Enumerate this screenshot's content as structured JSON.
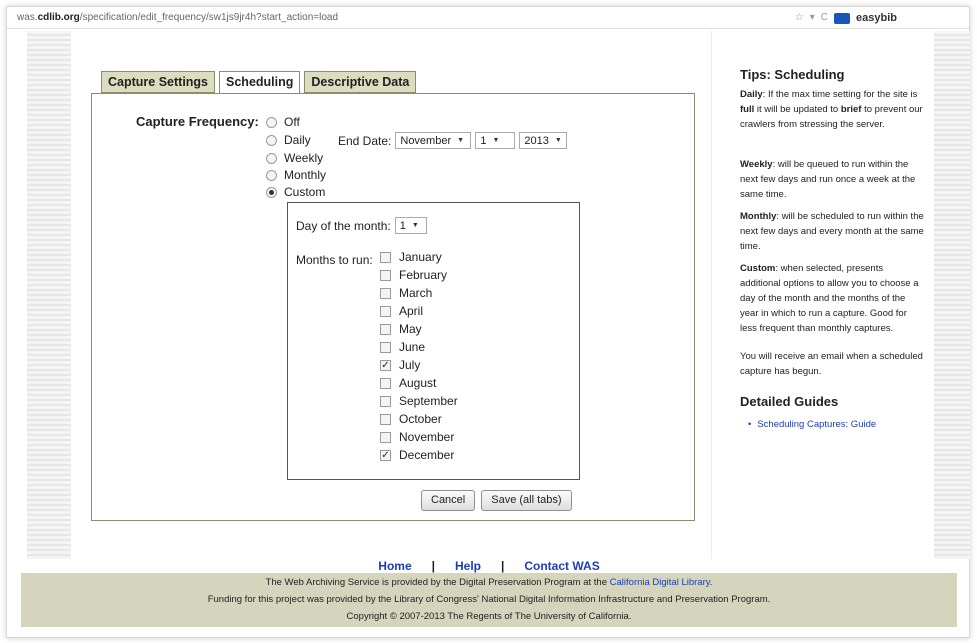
{
  "browser": {
    "url_prefix": "was.",
    "url_domain": "cdlib.org",
    "url_path": "/specification/edit_frequency/sw1js9jr4h?start_action=load",
    "search_engine": "easybib"
  },
  "tabs": [
    {
      "label": "Capture Settings"
    },
    {
      "label": "Scheduling"
    },
    {
      "label": "Descriptive Data"
    }
  ],
  "form": {
    "capture_frequency_label": "Capture Frequency:",
    "options": [
      {
        "label": "Off",
        "selected": false
      },
      {
        "label": "Daily",
        "selected": false
      },
      {
        "label": "Weekly",
        "selected": false
      },
      {
        "label": "Monthly",
        "selected": false
      },
      {
        "label": "Custom",
        "selected": true
      }
    ],
    "end_date": {
      "label": "End Date:",
      "month": "November",
      "day": "1",
      "year": "2013"
    },
    "custom": {
      "day_of_month_label": "Day of the month:",
      "day_of_month_value": "1",
      "months_label": "Months to run:",
      "months": [
        {
          "name": "January",
          "checked": false
        },
        {
          "name": "February",
          "checked": false
        },
        {
          "name": "March",
          "checked": false
        },
        {
          "name": "April",
          "checked": false
        },
        {
          "name": "May",
          "checked": false
        },
        {
          "name": "June",
          "checked": false
        },
        {
          "name": "July",
          "checked": true
        },
        {
          "name": "August",
          "checked": false
        },
        {
          "name": "September",
          "checked": false
        },
        {
          "name": "October",
          "checked": false
        },
        {
          "name": "November",
          "checked": false
        },
        {
          "name": "December",
          "checked": true
        }
      ]
    },
    "cancel_label": "Cancel",
    "save_label": "Save (all tabs)"
  },
  "sidebar": {
    "title": "Tips: Scheduling",
    "daily_term": "Daily",
    "daily_text_1": ": If the max time setting for the site is ",
    "daily_full": "full",
    "daily_text_2": " it will be updated to ",
    "daily_brief": "brief",
    "daily_text_3": " to prevent our crawlers from stressing the server.",
    "weekly_term": "Weekly",
    "weekly_text": ": will be queued to run within the next few days and run once a week at the same time.",
    "monthly_term": "Monthly",
    "monthly_text": ": will be scheduled to run within the next few days and every month at the same time.",
    "custom_term": "Custom",
    "custom_text": ": when selected, presents additional options to allow you to choose a day of the month and the months of the year in which to run a capture. Good for less frequent than monthly captures.",
    "email_note": "You will receive an email when a scheduled capture has begun.",
    "guides_title": "Detailed Guides",
    "guide_link": "Scheduling Captures: Guide"
  },
  "footer": {
    "nav": [
      "Home",
      "Help",
      "Contact WAS"
    ],
    "separator": "|",
    "line1_pre": "The Web Archiving Service is provided by the Digital Preservation Program at the ",
    "line1_link": "California Digital Library",
    "line1_post": ".",
    "line2": "Funding for this project was provided by the Library of Congress' National Digital Information Infrastructure and Preservation Program.",
    "line3": "Copyright © 2007-2013 The Regents of The University of California."
  }
}
